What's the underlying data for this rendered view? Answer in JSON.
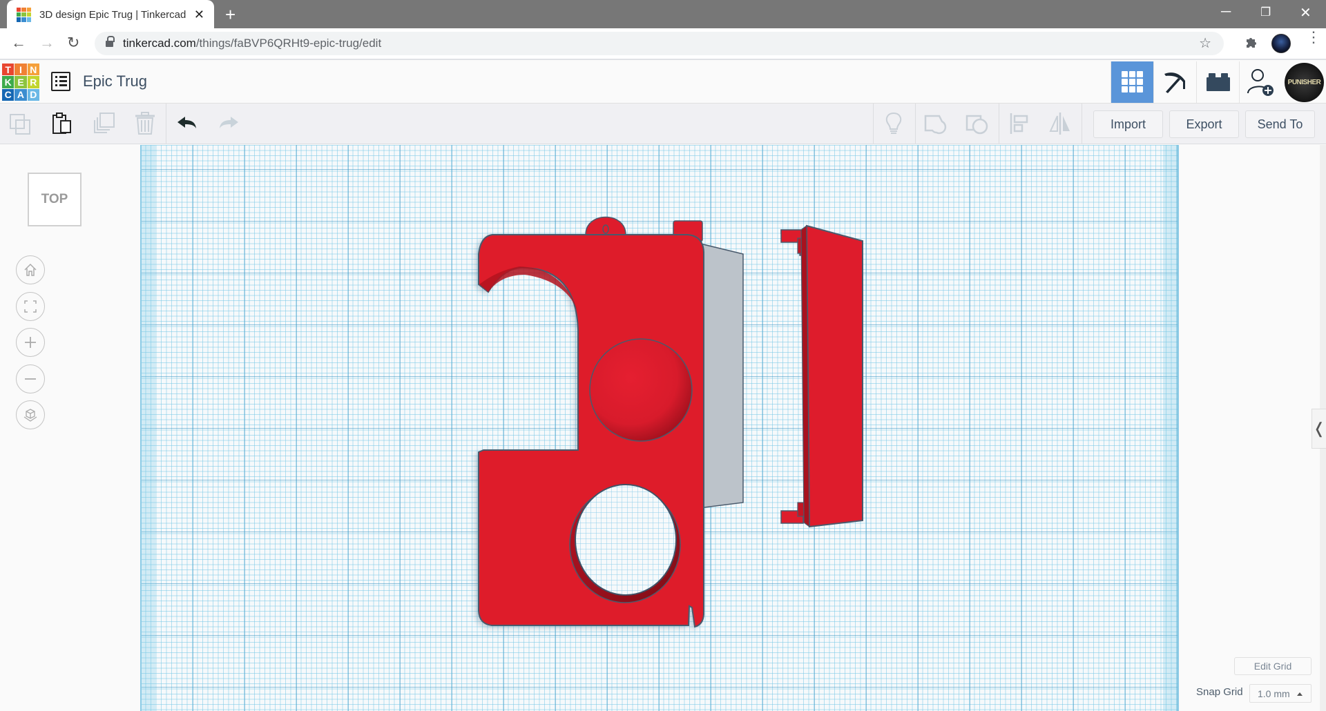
{
  "browser": {
    "tab_title": "3D design Epic Trug | Tinkercad",
    "url_host": "tinkercad.com",
    "url_path": "/things/faBVP6QRHt9-epic-trug/edit",
    "new_tab": "+",
    "close_tab": "✕"
  },
  "app": {
    "logo_letters": [
      "T",
      "I",
      "N",
      "K",
      "E",
      "R",
      "C",
      "A",
      "D"
    ],
    "logo_colors": [
      "#e8462f",
      "#f08133",
      "#f5a03a",
      "#3eab4b",
      "#8cc43e",
      "#c2d52f",
      "#1567b3",
      "#3b8dd0",
      "#6ab8e6"
    ],
    "design_title": "Epic Trug",
    "header_buttons": [
      {
        "name": "3d-design-view",
        "icon": "grid-icon",
        "active": true
      },
      {
        "name": "codeblocks",
        "icon": "pickaxe-icon",
        "active": false
      },
      {
        "name": "bricks",
        "icon": "brick-icon",
        "active": false
      },
      {
        "name": "invite-user",
        "icon": "add-user-icon",
        "active": false
      }
    ],
    "avatar_text": "PUNISHER",
    "accent_color": "#5a95d9"
  },
  "toolbar": {
    "copy": "Copy",
    "paste": "Paste",
    "duplicate": "Duplicate",
    "delete": "Delete",
    "undo": "Undo",
    "redo": "Redo",
    "import_label": "Import",
    "export_label": "Export",
    "send_to_label": "Send To"
  },
  "view": {
    "cube_label": "TOP",
    "controls": [
      "home-view",
      "fit-all",
      "zoom-in",
      "zoom-out",
      "perspective"
    ]
  },
  "grid": {
    "edit_grid_label": "Edit Grid",
    "snap_grid_label": "Snap Grid",
    "snap_value": "1.0 mm"
  },
  "scene": {
    "object_color": "#de1c2c",
    "hole_color": "#bcc3ca"
  }
}
